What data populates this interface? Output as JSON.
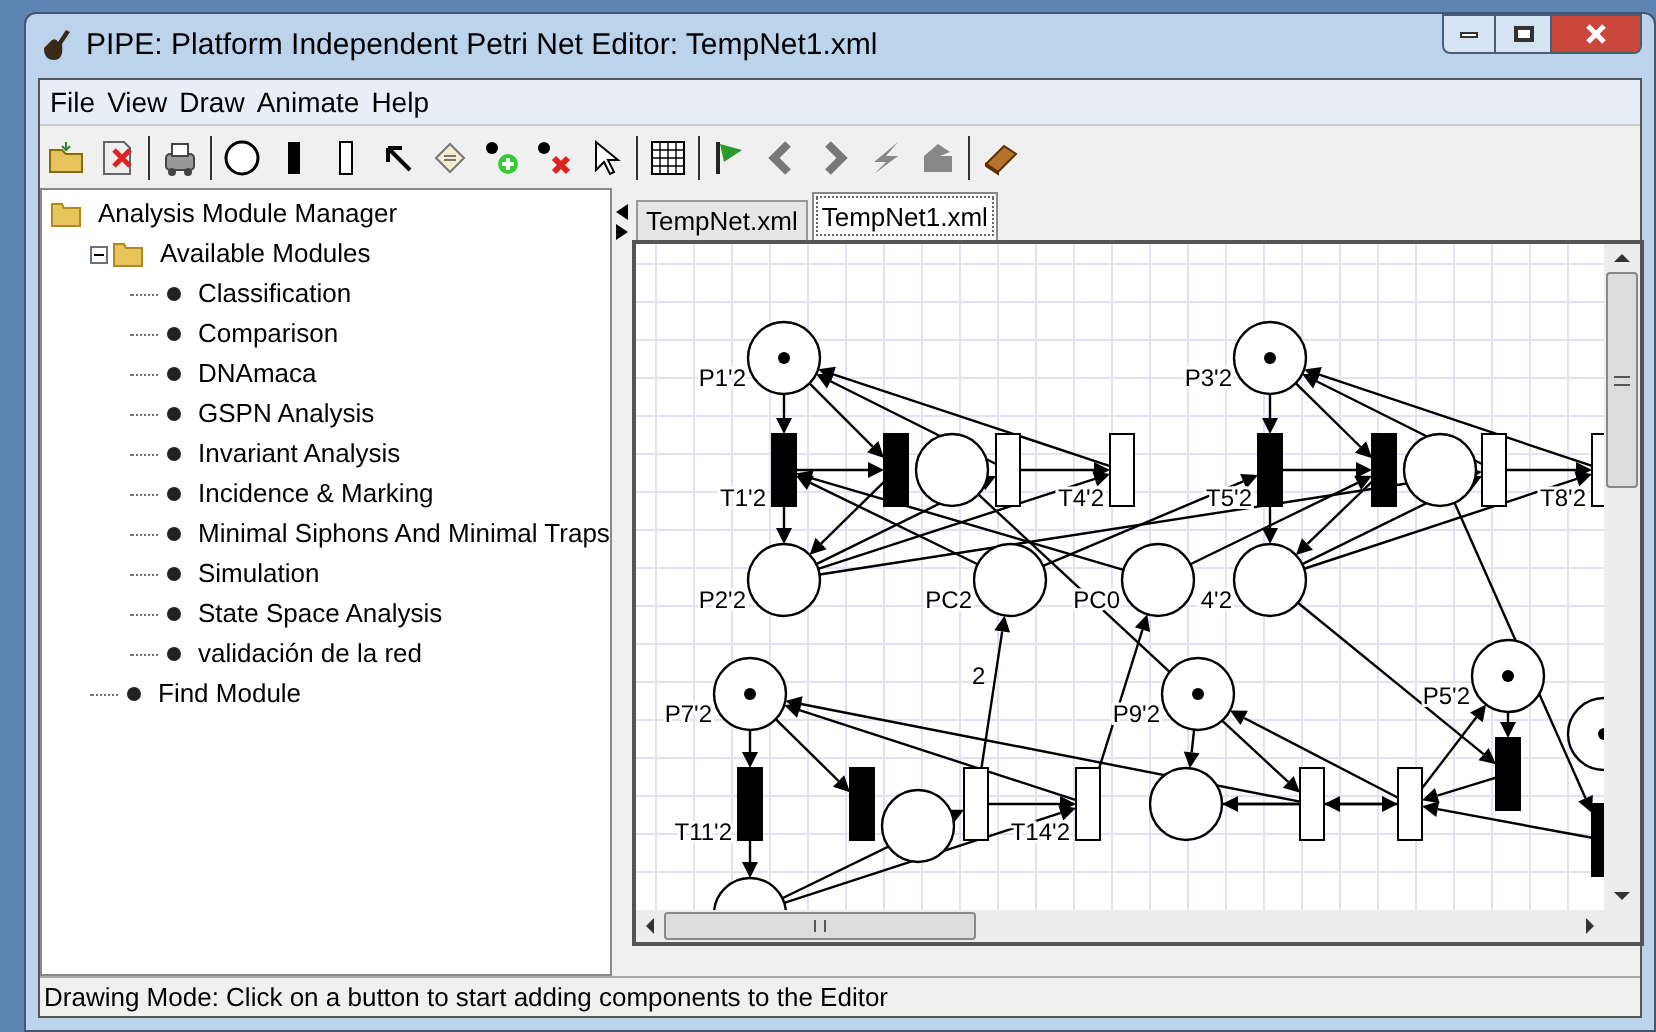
{
  "window": {
    "title": "PIPE: Platform Independent Petri Net Editor: TempNet1.xml"
  },
  "menu": [
    "File",
    "View",
    "Draw",
    "Animate",
    "Help"
  ],
  "tree": {
    "label": "Analysis Module Manager",
    "kind": "folder",
    "children": [
      {
        "label": "Available Modules",
        "kind": "folder",
        "expanded": true,
        "children": [
          {
            "label": "Classification",
            "kind": "module"
          },
          {
            "label": "Comparison",
            "kind": "module"
          },
          {
            "label": "DNAmaca",
            "kind": "module"
          },
          {
            "label": "GSPN Analysis",
            "kind": "module"
          },
          {
            "label": "Invariant Analysis",
            "kind": "module"
          },
          {
            "label": "Incidence & Marking",
            "kind": "module"
          },
          {
            "label": "Minimal Siphons And Minimal Traps",
            "kind": "module"
          },
          {
            "label": "Simulation",
            "kind": "module"
          },
          {
            "label": "State Space Analysis",
            "kind": "module"
          },
          {
            "label": "validación de la red",
            "kind": "module"
          }
        ]
      },
      {
        "label": "Find Module",
        "kind": "module"
      }
    ]
  },
  "tabs": [
    {
      "label": "TempNet.xml",
      "selected": false
    },
    {
      "label": "TempNet1.xml",
      "selected": true
    }
  ],
  "net": {
    "places": [
      {
        "label": "P1'2",
        "token": true
      },
      {
        "label": "P2'2",
        "token": false
      },
      {
        "token": false
      },
      {
        "label": "PC2",
        "token": false
      },
      {
        "label": "PC0",
        "token": false
      },
      {
        "label": "P3'2",
        "token": true
      },
      {
        "label": "4'2",
        "token": false
      },
      {
        "token": false
      },
      {
        "label": "P7'2",
        "token": true
      },
      {
        "label": "P9'2",
        "token": true
      },
      {
        "label": "P5'2",
        "token": true
      },
      {
        "token": false
      },
      {
        "token": false
      },
      {
        "token": false
      },
      {
        "token": true
      }
    ],
    "transitions": [
      {
        "label": "T1'2",
        "kind": "immediate"
      },
      {
        "kind": "immediate"
      },
      {
        "kind": "timed"
      },
      {
        "label": "T4'2",
        "kind": "timed"
      },
      {
        "label": "T5'2",
        "kind": "immediate"
      },
      {
        "kind": "immediate"
      },
      {
        "kind": "timed"
      },
      {
        "label": "T8'2",
        "kind": "timed"
      },
      {
        "label": "T11'2",
        "kind": "immediate"
      },
      {
        "kind": "immediate"
      },
      {
        "kind": "timed"
      },
      {
        "label": "T14'2",
        "kind": "timed"
      },
      {
        "kind": "timed"
      },
      {
        "kind": "timed"
      },
      {
        "kind": "immediate"
      },
      {
        "kind": "immediate"
      }
    ],
    "arc_labels": [
      {
        "text": "2"
      }
    ]
  },
  "status_bar": "Drawing Mode: Click on a button to start adding components to the Editor"
}
